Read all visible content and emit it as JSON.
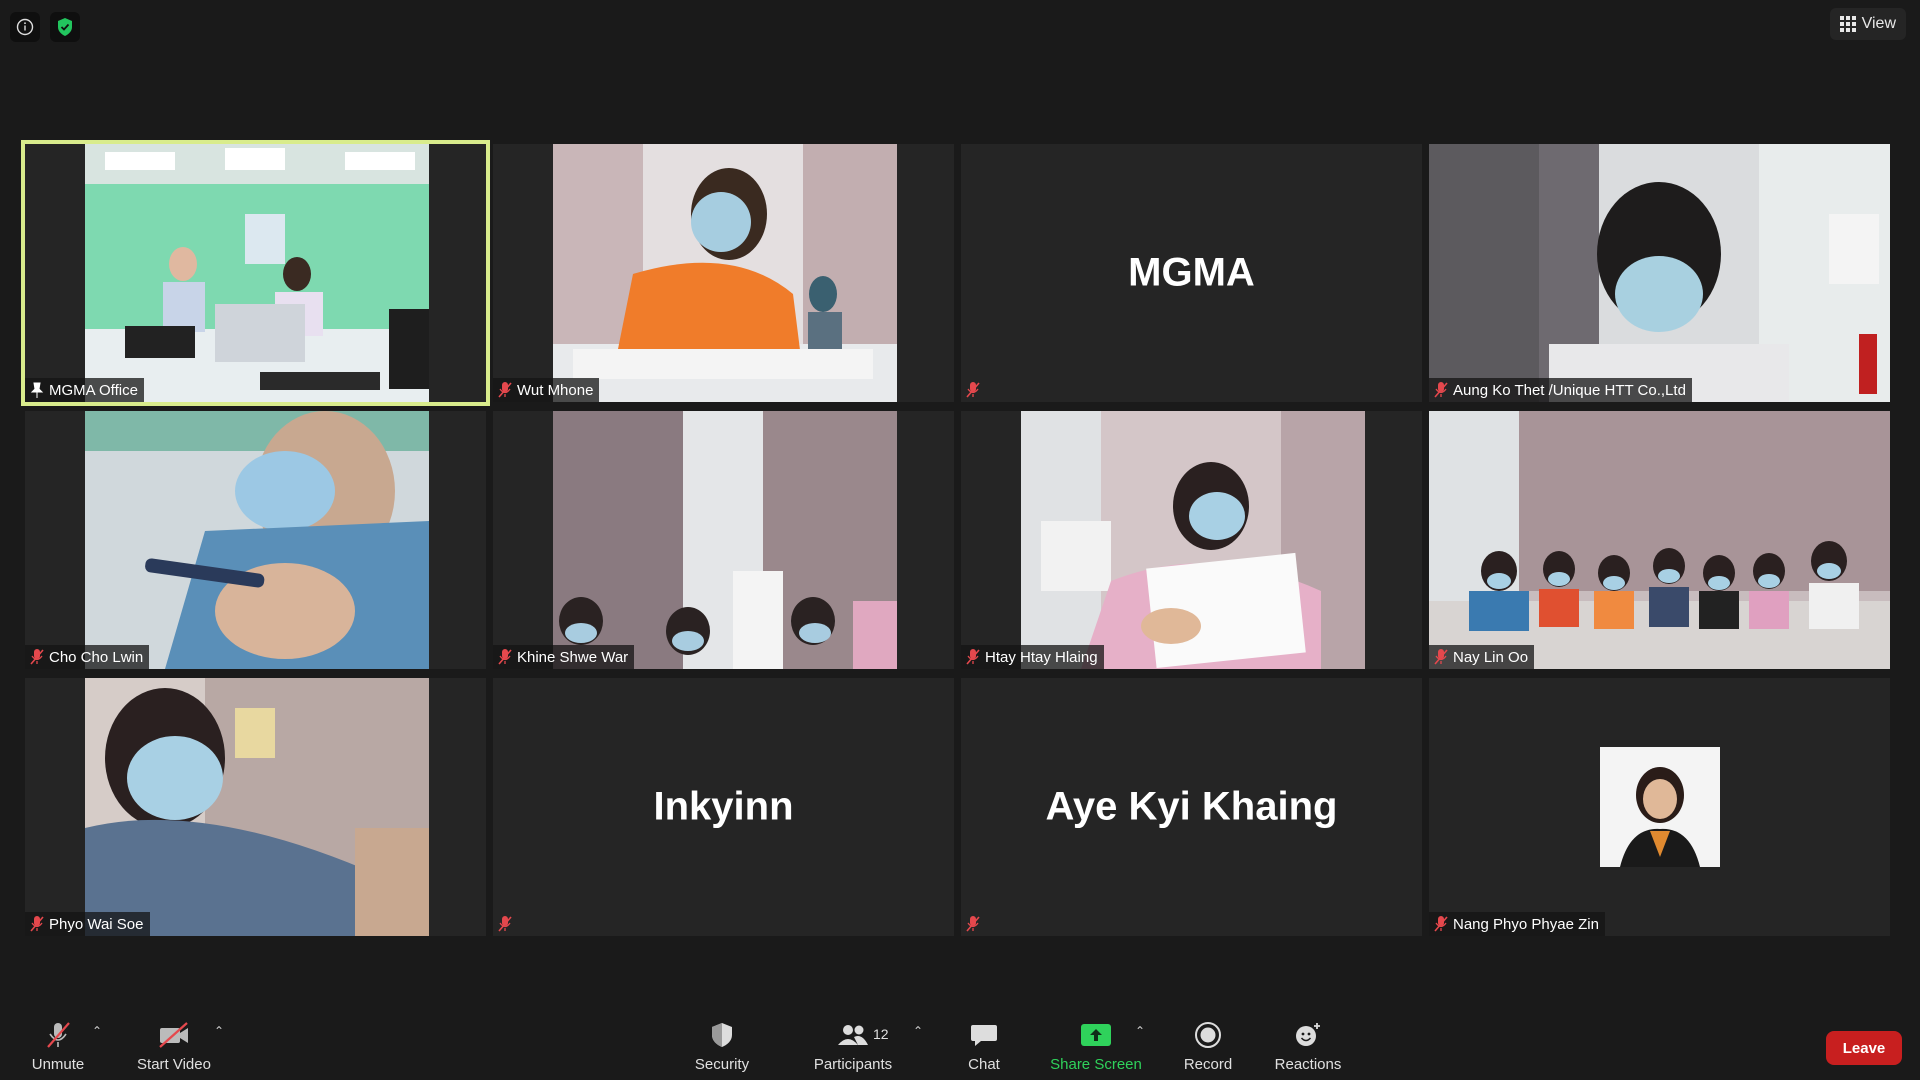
{
  "topbar": {
    "view_label": "View",
    "icons": [
      "info-icon",
      "shield-check-icon",
      "grid-icon"
    ],
    "shield_color": "#22c55e"
  },
  "participants": [
    {
      "name": "MGMA Office",
      "has_video": true,
      "active_speaker": true,
      "pinned": true,
      "muted": false
    },
    {
      "name": "Wut Mhone",
      "has_video": true,
      "muted": true
    },
    {
      "name": "",
      "display_name": "MGMA",
      "has_video": false,
      "muted": true
    },
    {
      "name": "Aung Ko Thet /Unique HTT Co.,Ltd",
      "has_video": true,
      "muted": true
    },
    {
      "name": "Cho Cho Lwin",
      "has_video": true,
      "muted": true
    },
    {
      "name": "Khine Shwe War",
      "has_video": true,
      "muted": true
    },
    {
      "name": "Htay Htay Hlaing",
      "has_video": true,
      "muted": true
    },
    {
      "name": "Nay Lin Oo",
      "has_video": true,
      "muted": true
    },
    {
      "name": "Phyo Wai Soe",
      "has_video": true,
      "muted": true
    },
    {
      "name": "",
      "display_name": "Inkyinn",
      "has_video": false,
      "muted": true
    },
    {
      "name": "",
      "display_name": "Aye Kyi Khaing",
      "has_video": false,
      "muted": true
    },
    {
      "name": "Nang Phyo Phyae Zin",
      "has_video": false,
      "has_avatar": true,
      "muted": true
    }
  ],
  "toolbar": {
    "unmute": "Unmute",
    "start_video": "Start Video",
    "security": "Security",
    "participants": "Participants",
    "participants_count": "12",
    "chat": "Chat",
    "share_screen": "Share Screen",
    "record": "Record",
    "reactions": "Reactions",
    "leave": "Leave"
  },
  "colors": {
    "active_border": "#d9ec8c",
    "mute_red": "#e5484d",
    "share_green": "#2fd25b",
    "leave_red": "#c81f1f"
  }
}
